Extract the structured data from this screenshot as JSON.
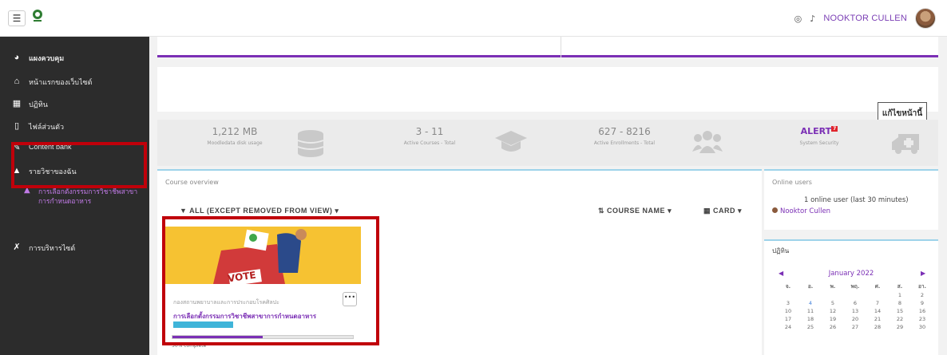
{
  "topbar": {
    "menu_icon": "hamburger-icon",
    "user_name": "NOOKTOR CULLEN"
  },
  "sidebar": {
    "items": [
      {
        "label": "แผงควบคุม",
        "icon": "dashboard-icon"
      },
      {
        "label": "หน้าแรกของเว็บไซต์",
        "icon": "home-icon"
      },
      {
        "label": "ปฏิทิน",
        "icon": "calendar-icon"
      },
      {
        "label": "ไฟล์ส่วนตัว",
        "icon": "file-icon"
      },
      {
        "label": "Content bank",
        "icon": "paint-icon"
      },
      {
        "label": "รายวิชาของฉัน",
        "icon": "graduation-cap-icon"
      },
      {
        "label": "การเลือกตั้งกรรมการวิชาชีพสาขาการกำหนดอาหาร",
        "icon": "graduation-cap-icon"
      },
      {
        "label": "การบริหารไซต์",
        "icon": "wrench-icon"
      }
    ]
  },
  "header": {
    "edit_button": "แก้ไขหน้านี้"
  },
  "stats": [
    {
      "value": "1,212 MB",
      "label": "Moodledata disk usage",
      "icon": "database-icon"
    },
    {
      "value": "3 - 11",
      "label": "Active Courses - Total",
      "icon": "graduation-cap-icon"
    },
    {
      "value": "627 - 8216",
      "label": "Active Enrollments - Total",
      "icon": "users-icon"
    },
    {
      "value": "ALERT",
      "badge": "7",
      "label": "System Security",
      "icon": "ambulance-icon"
    }
  ],
  "course_overview": {
    "title": "Course overview",
    "filter": "ALL (EXCEPT REMOVED FROM VIEW)",
    "sort": "COURSE NAME",
    "view": "CARD",
    "card": {
      "category": "กองสถานพยาบาลและการประกอบโรคศิลปะ",
      "title": "การเลือกตั้งกรรมการวิชาชีพสาขาการกำหนดอาหาร",
      "image_text": "VOTE",
      "progress_percent": 50,
      "progress_label": "50% complete"
    }
  },
  "online_users": {
    "title": "Online users",
    "summary": "1 online user (last 30 minutes)",
    "user": "Nooktor Cullen"
  },
  "calendar": {
    "title": "ปฏิทิน",
    "month": "January 2022",
    "weekdays": [
      "จ.",
      "อ.",
      "พ.",
      "พฤ.",
      "ศ.",
      "ส.",
      "อา."
    ],
    "days": [
      "",
      "",
      "",
      "",
      "",
      "1",
      "2",
      "3",
      "4",
      "5",
      "6",
      "7",
      "8",
      "9",
      "10",
      "11",
      "12",
      "13",
      "14",
      "15",
      "16",
      "17",
      "18",
      "19",
      "20",
      "21",
      "22",
      "23",
      "24",
      "25",
      "26",
      "27",
      "28",
      "29",
      "30"
    ]
  },
  "colors": {
    "accent": "#7b2fb5",
    "sidebar": "#2c2c2c",
    "highlight": "#c0000a"
  }
}
